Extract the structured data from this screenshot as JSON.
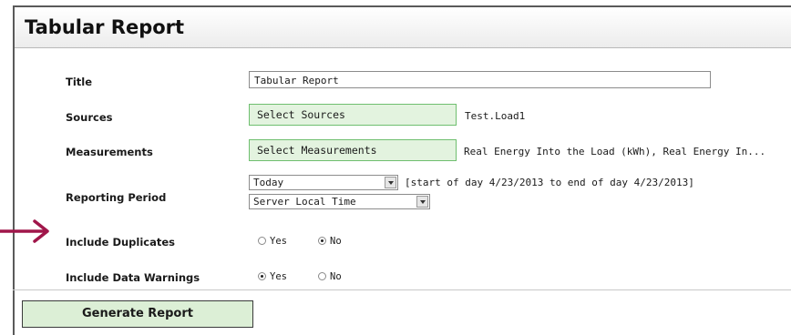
{
  "panel": {
    "title": "Tabular Report"
  },
  "fields": {
    "title": {
      "label": "Title",
      "value": "Tabular Report"
    },
    "sources": {
      "label": "Sources",
      "button": "Select Sources",
      "selected": "Test.Load1"
    },
    "measurements": {
      "label": "Measurements",
      "button": "Select Measurements",
      "selected": "Real Energy Into the Load (kWh), Real Energy In..."
    },
    "reporting_period": {
      "label": "Reporting Period",
      "period_value": "Today",
      "range_text": "[start of day 4/23/2013 to end of day 4/23/2013]",
      "timezone_value": "Server Local Time"
    },
    "include_duplicates": {
      "label": "Include Duplicates",
      "yes": "Yes",
      "no": "No",
      "selected": "No"
    },
    "include_data_warnings": {
      "label": "Include Data Warnings",
      "yes": "Yes",
      "no": "No",
      "selected": "Yes"
    }
  },
  "actions": {
    "generate": "Generate Report"
  },
  "colors": {
    "annotation_arrow": "#a0164a",
    "button_green_fill": "#e3f3df",
    "button_green_border": "#6fbf6f"
  },
  "icons": {
    "annotation": "arrow-right-icon",
    "dropdown": "chevron-down-icon"
  }
}
